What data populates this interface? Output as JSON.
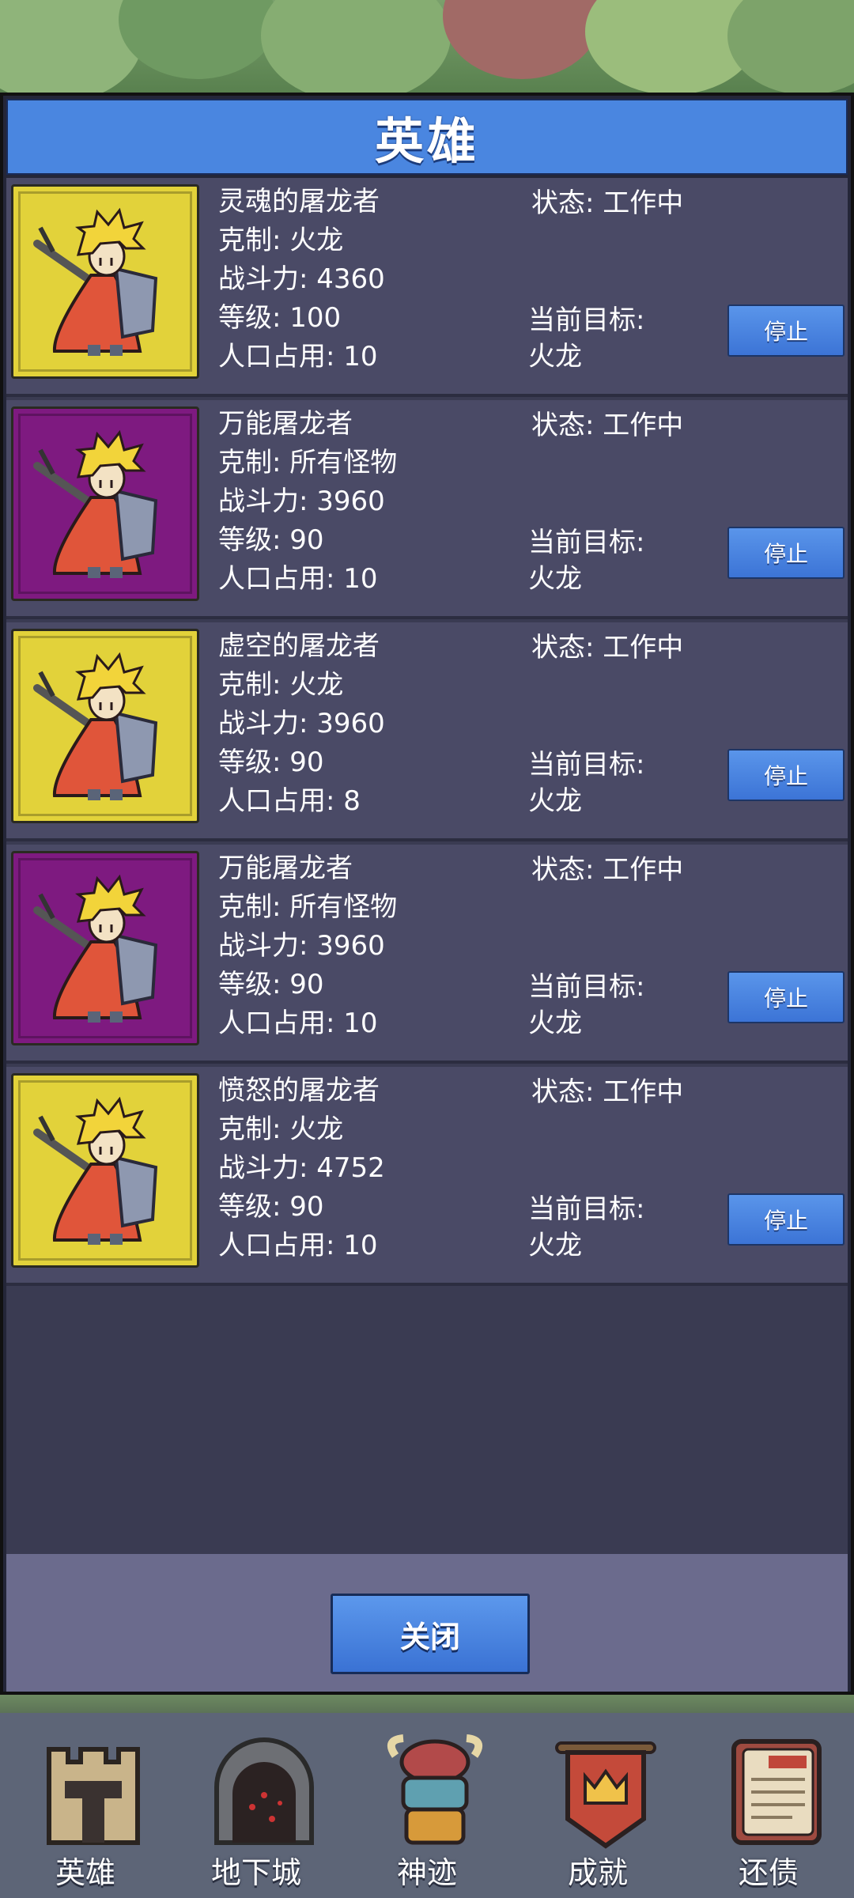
{
  "dialog": {
    "title": "英雄",
    "close_label": "关闭"
  },
  "heroes": [
    {
      "name": "灵魂的屠龙者",
      "counter": "克制: 火龙",
      "power": "战斗力: 4360",
      "level": "等级: 100",
      "population": "人口占用: 10",
      "status": "状态: 工作中",
      "target_label": "当前目标:",
      "target_value": "火龙",
      "stop_label": "停止",
      "frame_color": "#e2d23a"
    },
    {
      "name": "万能屠龙者",
      "counter": "克制: 所有怪物",
      "power": "战斗力: 3960",
      "level": "等级: 90",
      "population": "人口占用: 10",
      "status": "状态: 工作中",
      "target_label": "当前目标:",
      "target_value": "火龙",
      "stop_label": "停止",
      "frame_color": "#7e1a80"
    },
    {
      "name": "虚空的屠龙者",
      "counter": "克制: 火龙",
      "power": "战斗力: 3960",
      "level": "等级: 90",
      "population": "人口占用: 8",
      "status": "状态: 工作中",
      "target_label": "当前目标:",
      "target_value": "火龙",
      "stop_label": "停止",
      "frame_color": "#e2d23a"
    },
    {
      "name": "万能屠龙者",
      "counter": "克制: 所有怪物",
      "power": "战斗力: 3960",
      "level": "等级: 90",
      "population": "人口占用: 10",
      "status": "状态: 工作中",
      "target_label": "当前目标:",
      "target_value": "火龙",
      "stop_label": "停止",
      "frame_color": "#7e1a80"
    },
    {
      "name": "愤怒的屠龙者",
      "counter": "克制: 火龙",
      "power": "战斗力: 4752",
      "level": "等级: 90",
      "population": "人口占用: 10",
      "status": "状态: 工作中",
      "target_label": "当前目标:",
      "target_value": "火龙",
      "stop_label": "停止",
      "frame_color": "#e2d23a"
    }
  ],
  "bottom_nav": [
    {
      "label": "英雄",
      "icon": "castle-tower-icon"
    },
    {
      "label": "地下城",
      "icon": "dungeon-gate-icon"
    },
    {
      "label": "神迹",
      "icon": "totem-icon"
    },
    {
      "label": "成就",
      "icon": "banner-crown-icon"
    },
    {
      "label": "还债",
      "icon": "ledger-book-icon"
    }
  ]
}
